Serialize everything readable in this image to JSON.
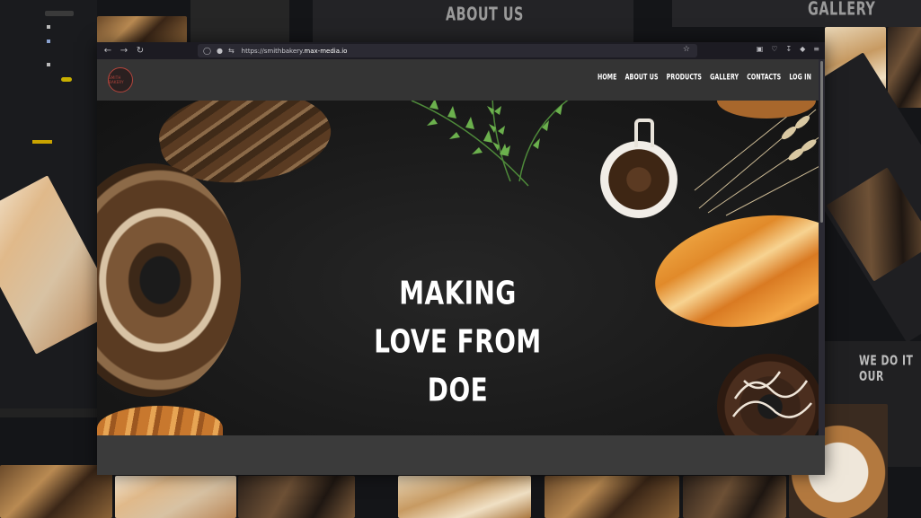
{
  "background": {
    "about_us_heading": "ABOUT US",
    "gallery_heading": "GALLERY",
    "side_heading": "WE DO IT OUR"
  },
  "browser": {
    "url_prefix": "https://smithbakery.",
    "url_host": "max-media.io",
    "back_icon": "arrow-left-icon",
    "forward_icon": "arrow-right-icon",
    "reload_icon": "reload-icon"
  },
  "site": {
    "logo_text": "SMITH BAKERY",
    "menu": [
      {
        "label": "HOME"
      },
      {
        "label": "ABOUT US"
      },
      {
        "label": "PRODUCTS"
      },
      {
        "label": "GALLERY"
      },
      {
        "label": "CONTACTS"
      },
      {
        "label": "LOG IN"
      }
    ],
    "hero": {
      "line1": "MAKING",
      "line2": "LOVE FROM",
      "line3": "DOE"
    }
  },
  "colors": {
    "header_bg": "#343434",
    "hero_bg": "#1b1b1b",
    "logo_accent": "#b3453c"
  }
}
